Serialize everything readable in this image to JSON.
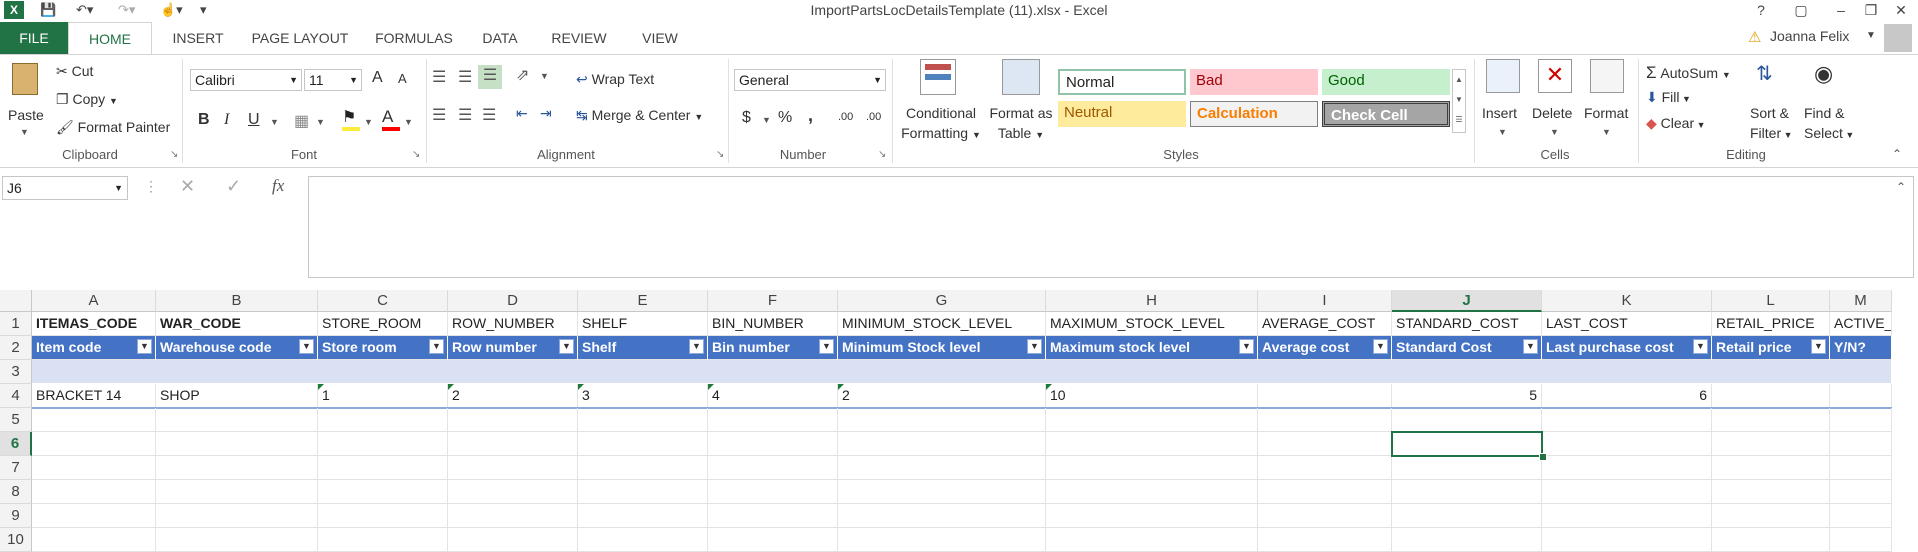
{
  "window": {
    "title": "ImportPartsLocDetailsTemplate (11).xlsx - Excel",
    "help": "?",
    "user": "Joanna Felix"
  },
  "tabs": [
    "FILE",
    "HOME",
    "INSERT",
    "PAGE LAYOUT",
    "FORMULAS",
    "DATA",
    "REVIEW",
    "VIEW"
  ],
  "ribbon": {
    "clipboard": {
      "label": "Clipboard",
      "paste": "Paste",
      "cut": "Cut",
      "copy": "Copy",
      "format_painter": "Format Painter"
    },
    "font": {
      "label": "Font",
      "name": "Calibri",
      "size": "11",
      "grow": "A",
      "shrink": "A",
      "bold": "B",
      "italic": "I",
      "underline": "U",
      "font_color": "A"
    },
    "alignment": {
      "label": "Alignment",
      "wrap": "Wrap Text",
      "merge": "Merge & Center"
    },
    "number": {
      "label": "Number",
      "format": "General",
      "currency": "$",
      "percent": "%",
      "comma": ",",
      "inc_dec": ".00",
      "dec_dec": ".00"
    },
    "styles": {
      "label": "Styles",
      "conditional": [
        "Conditional",
        "Formatting"
      ],
      "format_table": [
        "Format as",
        "Table"
      ],
      "normal": "Normal",
      "bad": "Bad",
      "good": "Good",
      "neutral": "Neutral",
      "calculation": "Calculation",
      "check": "Check Cell"
    },
    "cells": {
      "label": "Cells",
      "insert": "Insert",
      "delete": "Delete",
      "format": "Format"
    },
    "editing": {
      "label": "Editing",
      "autosum": "AutoSum",
      "fill": "Fill",
      "clear": "Clear",
      "sort": [
        "Sort &",
        "Filter"
      ],
      "find": [
        "Find &",
        "Select"
      ]
    }
  },
  "formula_bar": {
    "name_box": "J6",
    "fx": "fx",
    "value": ""
  },
  "grid": {
    "columns": [
      "A",
      "B",
      "C",
      "D",
      "E",
      "F",
      "G",
      "H",
      "I",
      "J",
      "K",
      "L",
      "M"
    ],
    "rows": [
      "1",
      "2",
      "3",
      "4",
      "5",
      "6",
      "7",
      "8",
      "9",
      "10"
    ],
    "row1": [
      "ITEMAS_CODE",
      "WAR_CODE",
      "STORE_ROOM",
      "ROW_NUMBER",
      "SHELF",
      "BIN_NUMBER",
      "MINIMUM_STOCK_LEVEL",
      "MAXIMUM_STOCK_LEVEL",
      "AVERAGE_COST",
      "STANDARD_COST",
      "LAST_COST",
      "RETAIL_PRICE",
      "ACTIVE_"
    ],
    "row2": [
      "Item code",
      "Warehouse code",
      "Store room",
      "Row number",
      "Shelf",
      "Bin number",
      "Minimum Stock level",
      "Maximum stock level",
      "Average cost",
      "Standard Cost",
      "Last purchase cost",
      "Retail price",
      "Y/N?"
    ],
    "row4": [
      "BRACKET 14",
      "SHOP",
      "1",
      "2",
      "3",
      "4",
      "2",
      "10",
      "",
      "5",
      "6",
      "",
      ""
    ],
    "selected_cell": "J6"
  }
}
